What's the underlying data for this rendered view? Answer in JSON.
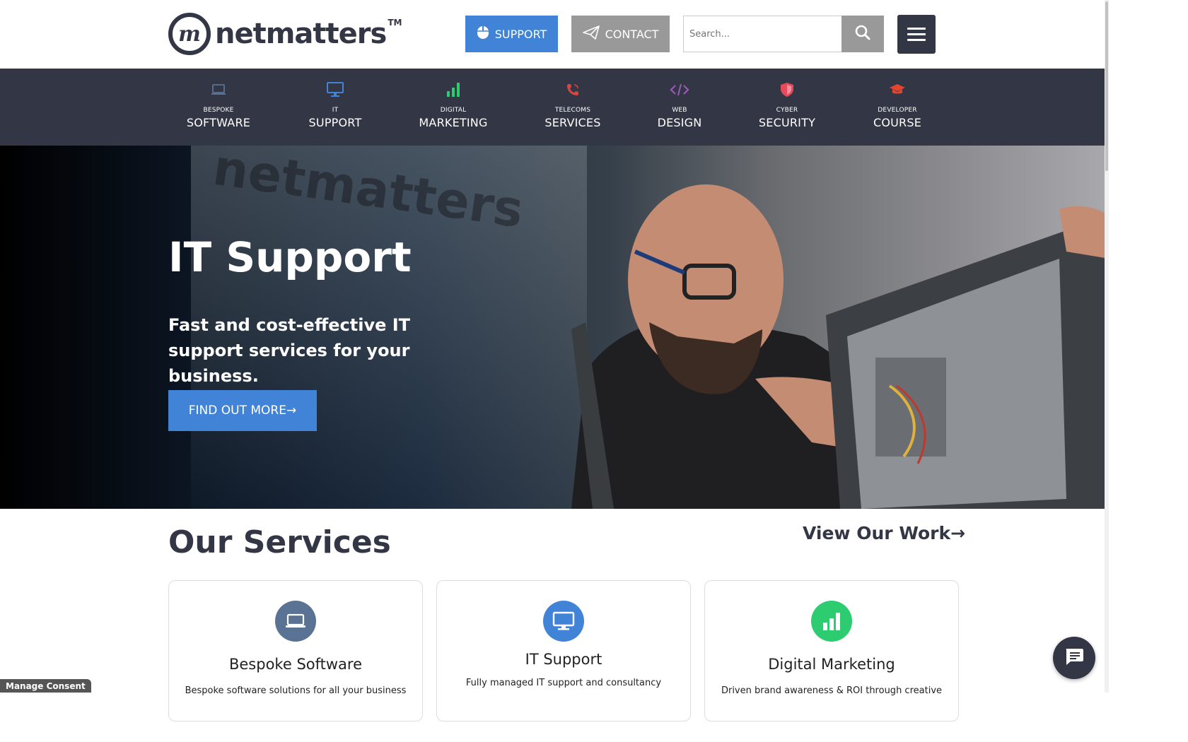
{
  "header": {
    "logo_text": "netmatters",
    "logo_mark": "m",
    "logo_tm": "TM",
    "support_label": "SUPPORT",
    "contact_label": "CONTACT",
    "search_placeholder": "Search...",
    "icons": {
      "support": "mouse-icon",
      "contact": "paper-plane-icon",
      "search": "search-icon",
      "menu": "hamburger-icon"
    }
  },
  "nav": [
    {
      "small": "BESPOKE",
      "big": "SOFTWARE",
      "icon": "laptop-icon",
      "color": "#5a7394"
    },
    {
      "small": "IT",
      "big": "SUPPORT",
      "icon": "monitor-icon",
      "color": "#4183d7"
    },
    {
      "small": "DIGITAL",
      "big": "MARKETING",
      "icon": "bar-chart-icon",
      "color": "#2ecc71"
    },
    {
      "small": "TELECOMS",
      "big": "SERVICES",
      "icon": "phone-icon",
      "color": "#d64541"
    },
    {
      "small": "WEB",
      "big": "DESIGN",
      "icon": "code-icon",
      "color": "#9b59b6"
    },
    {
      "small": "CYBER",
      "big": "SECURITY",
      "icon": "shield-icon",
      "color": "#e64a5b"
    },
    {
      "small": "DEVELOPER",
      "big": "COURSE",
      "icon": "graduation-cap-icon",
      "color": "#e6442c"
    }
  ],
  "hero": {
    "wall_text": "netmatters",
    "title": "IT Support",
    "subtitle": "Fast and cost-effective IT support services for your business.",
    "button": "FIND OUT MORE→"
  },
  "services": {
    "title": "Our Services",
    "view_work": "View Our Work→",
    "cards": [
      {
        "title": "Bespoke Software",
        "desc": "Bespoke software solutions for all your business",
        "icon": "laptop-icon",
        "color": "#5a7394"
      },
      {
        "title": "IT Support",
        "desc": "Fully managed IT support and consultancy",
        "icon": "monitor-icon",
        "color": "#4183d7"
      },
      {
        "title": "Digital Marketing",
        "desc": "Driven brand awareness & ROI through creative",
        "icon": "bar-chart-icon",
        "color": "#2ecc71"
      }
    ]
  },
  "footer": {
    "consent": "Manage Consent",
    "chat_icon": "chat-icon"
  }
}
